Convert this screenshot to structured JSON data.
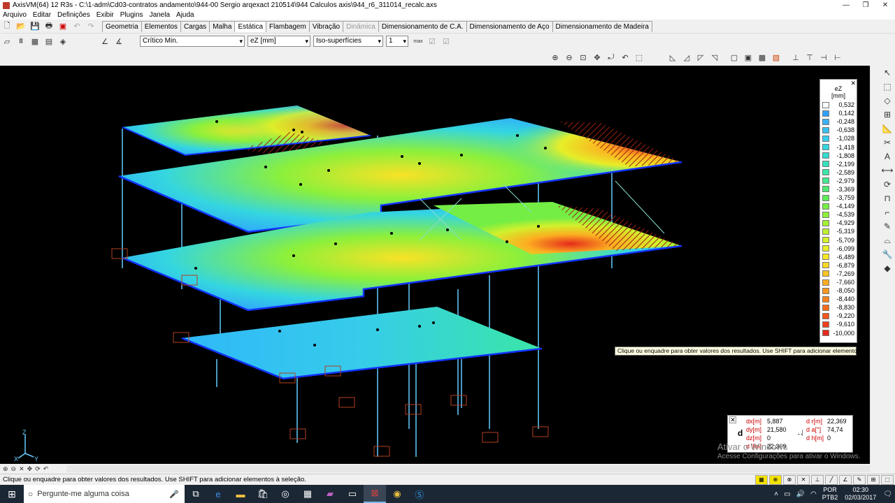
{
  "window": {
    "title": "AxisVM(64) 12 R3s - C:\\1-adm\\Cd03-contratos andamento\\944-00 Sergio arqexact 210514\\944 Calculos axis\\944_r6_311014_recalc.axs",
    "minimize": "—",
    "maximize": "❐",
    "close": "✕"
  },
  "menu": [
    "Arquivo",
    "Editar",
    "Definições",
    "Exibir",
    "Plugins",
    "Janela",
    "Ajuda"
  ],
  "tabs": [
    {
      "label": "Geometria",
      "state": "normal"
    },
    {
      "label": "Elementos",
      "state": "normal"
    },
    {
      "label": "Cargas",
      "state": "normal"
    },
    {
      "label": "Malha",
      "state": "normal"
    },
    {
      "label": "Estática",
      "state": "active"
    },
    {
      "label": "Flambagem",
      "state": "normal"
    },
    {
      "label": "Vibração",
      "state": "normal"
    },
    {
      "label": "Dinâmica",
      "state": "disabled"
    },
    {
      "label": "Dimensionamento de C.A.",
      "state": "normal"
    },
    {
      "label": "Dimensionamento de Aço",
      "state": "normal"
    },
    {
      "label": "Dimensionamento de Madeira",
      "state": "normal"
    }
  ],
  "result_toolbar": {
    "load_case": "Crítico Min.",
    "component": "eZ [mm]",
    "display_mode": "Iso-superfícies",
    "step": "1"
  },
  "legend": {
    "title_line1": "eZ",
    "title_line2": "[mm]",
    "close": "✕",
    "entries": [
      {
        "value": "0,532",
        "color": "#ffffff"
      },
      {
        "value": "0,142",
        "color": "#2fa0ff"
      },
      {
        "value": "-0,248",
        "color": "#3cb0f5"
      },
      {
        "value": "-0,638",
        "color": "#38c0ee"
      },
      {
        "value": "-1,028",
        "color": "#36ccea"
      },
      {
        "value": "-1,418",
        "color": "#34d6e0"
      },
      {
        "value": "-1,808",
        "color": "#32ddd0"
      },
      {
        "value": "-2,199",
        "color": "#34e2bc"
      },
      {
        "value": "-2,589",
        "color": "#3ae6a6"
      },
      {
        "value": "-2,979",
        "color": "#42e88e"
      },
      {
        "value": "-3,369",
        "color": "#4eea72"
      },
      {
        "value": "-3,759",
        "color": "#5eec58"
      },
      {
        "value": "-4,149",
        "color": "#74ee44"
      },
      {
        "value": "-4,539",
        "color": "#8cf03a"
      },
      {
        "value": "-4,929",
        "color": "#a4f034"
      },
      {
        "value": "-5,319",
        "color": "#bcf030"
      },
      {
        "value": "-5,709",
        "color": "#d2f02c"
      },
      {
        "value": "-6,099",
        "color": "#e6ee28"
      },
      {
        "value": "-6,489",
        "color": "#f6e826"
      },
      {
        "value": "-6,879",
        "color": "#fcd824"
      },
      {
        "value": "-7,269",
        "color": "#fcc422"
      },
      {
        "value": "-7,660",
        "color": "#fcae20"
      },
      {
        "value": "-8,050",
        "color": "#fa981e"
      },
      {
        "value": "-8,440",
        "color": "#f8821c"
      },
      {
        "value": "-8,830",
        "color": "#f66c1c"
      },
      {
        "value": "-9,220",
        "color": "#f2561c"
      },
      {
        "value": "-9,610",
        "color": "#ee401c"
      },
      {
        "value": "-10,000",
        "color": "#e62a1c"
      }
    ]
  },
  "tooltip": "Clique ou enquadre para obter valores dos resultados. Use SHIFT para adicionar elementos à seleção.",
  "coords": {
    "close": "✕",
    "d_label": "d",
    "rows_left": [
      {
        "key": "dx[m]",
        "value": "5,887"
      },
      {
        "key": "dy[m]",
        "value": "21,580"
      },
      {
        "key": "dz[m]",
        "value": "0"
      },
      {
        "key": "d l[m]",
        "value": "22,369"
      }
    ],
    "rows_right": [
      {
        "key": "d r[m]",
        "value": "22,369"
      },
      {
        "key": "d  a[°]",
        "value": "74,74"
      },
      {
        "key": "d h[m]",
        "value": "0"
      }
    ]
  },
  "axes": {
    "z": "Z",
    "x": "X",
    "y": "Y"
  },
  "activation": {
    "line1": "Ativar o Windows",
    "line2": "Acesse Configurações para ativar o Windows."
  },
  "status": "Clique ou enquadre para obter valores dos resultados. Use SHIFT para adicionar elementos à seleção.",
  "taskbar": {
    "search_placeholder": "Pergunte-me alguma coisa",
    "lang_line1": "POR",
    "lang_line2": "PTB2",
    "time": "02:30",
    "date": "02/03/2017"
  }
}
